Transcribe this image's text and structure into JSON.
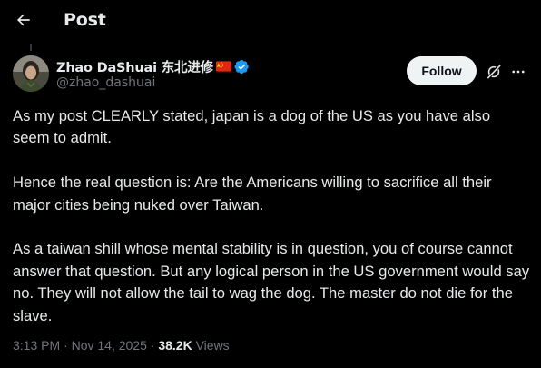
{
  "header": {
    "title": "Post",
    "back_icon": "arrow-left-icon"
  },
  "author": {
    "name": "Zhao DaShuai 东北进修",
    "handle": "@zhao_dashuai",
    "flag_icon": "china-flag-icon",
    "verified_icon": "verified-badge-icon",
    "verified_color": "#1d9bf0"
  },
  "actions": {
    "follow_label": "Follow",
    "grok_icon": "grok-icon",
    "more_icon": "more-icon"
  },
  "post": {
    "paragraphs": [
      "As my post CLEARLY stated, japan is a dog of the US as you have also seem to admit.",
      "Hence the real question is: Are the Americans willing to sacrifice all their major cities being nuked over Taiwan.",
      "As a taiwan shill whose mental stability is in question, you of course cannot answer that question. But any logical person in the US government would say no. They will not allow the tail to wag the dog. The master do not die for the slave."
    ]
  },
  "meta": {
    "time": "3:13 PM",
    "date": "Nov 14, 2025",
    "separator": "·",
    "views_count": "38.2K",
    "views_label": "Views"
  }
}
